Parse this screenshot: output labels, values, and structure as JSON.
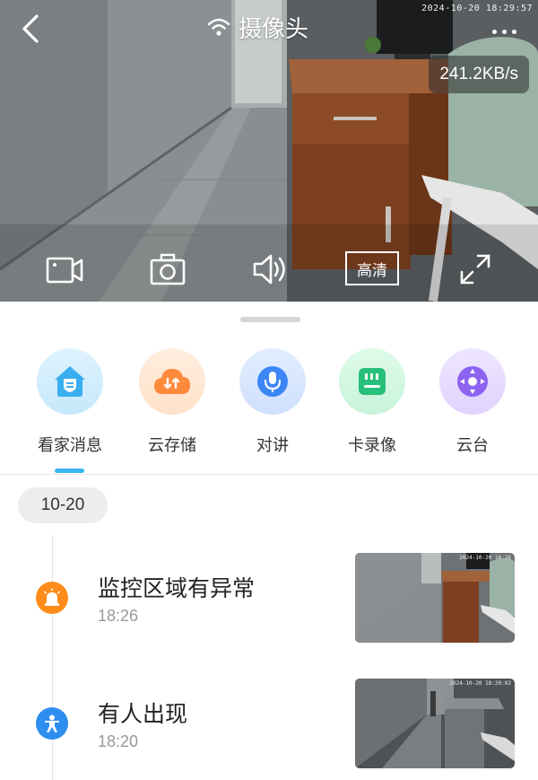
{
  "header": {
    "title": "摄像头",
    "osd_timestamp": "2024-10-20 18:29:57",
    "speed": "241.2KB/s"
  },
  "icons": {
    "back": "chevron-left-icon",
    "wifi": "wifi-icon",
    "more": "more-dots-icon",
    "record": "video-record-icon",
    "snapshot": "camera-snapshot-icon",
    "sound": "speaker-icon",
    "fullscreen": "fullscreen-icon"
  },
  "controls": {
    "quality_label": "高清"
  },
  "features": [
    {
      "label": "看家消息",
      "icon": "home-shield-icon",
      "color": "#3aaef0"
    },
    {
      "label": "云存储",
      "icon": "cloud-storage-icon",
      "color": "#ff8a3c"
    },
    {
      "label": "对讲",
      "icon": "microphone-icon",
      "color": "#3d86f5"
    },
    {
      "label": "卡录像",
      "icon": "sd-card-icon",
      "color": "#27c07a"
    },
    {
      "label": "云台",
      "icon": "ptz-direction-icon",
      "color": "#8d63f0"
    }
  ],
  "timeline": {
    "date": "10-20",
    "events": [
      {
        "title": "监控区域有异常",
        "time": "18:26",
        "icon": "alarm-icon",
        "color": "#ff8c1a",
        "thumb_stamp": "2024-10-20 18:26"
      },
      {
        "title": "有人出现",
        "time": "18:20",
        "icon": "person-icon",
        "color": "#2e8ef0",
        "thumb_stamp": "2024-10-20 18:20:02"
      }
    ]
  },
  "colors": {
    "accent": "#38b7f3",
    "text_primary": "#222222",
    "text_secondary": "#999999"
  }
}
